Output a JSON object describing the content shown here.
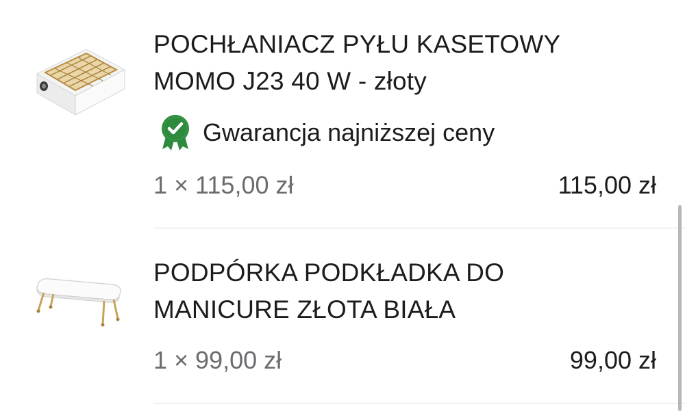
{
  "cart": {
    "items": [
      {
        "title_lines": [
          "POCHŁANIACZ PYŁU KASETOWY",
          "MOMO J23 40 W - złoty"
        ],
        "badge": {
          "icon": "guarantee-check-icon",
          "text": "Gwarancja najniższej ceny",
          "color": "#2e8b3e"
        },
        "quantity_price": "1 × 115,00 zł",
        "total": "115,00 zł",
        "image": "dust-collector-image"
      },
      {
        "title_lines": [
          "PODPÓRKA PODKŁADKA DO",
          "MANICURE ZŁOTA BIAŁA"
        ],
        "quantity_price": "1 × 99,00 zł",
        "total": "99,00 zł",
        "image": "manicure-armrest-image"
      }
    ]
  },
  "colors": {
    "text_primary": "#1c1c1e",
    "text_secondary": "#6b6b70",
    "divider": "#dedee0",
    "accent_green": "#2e8b3e",
    "gold": "#c9a35a"
  }
}
